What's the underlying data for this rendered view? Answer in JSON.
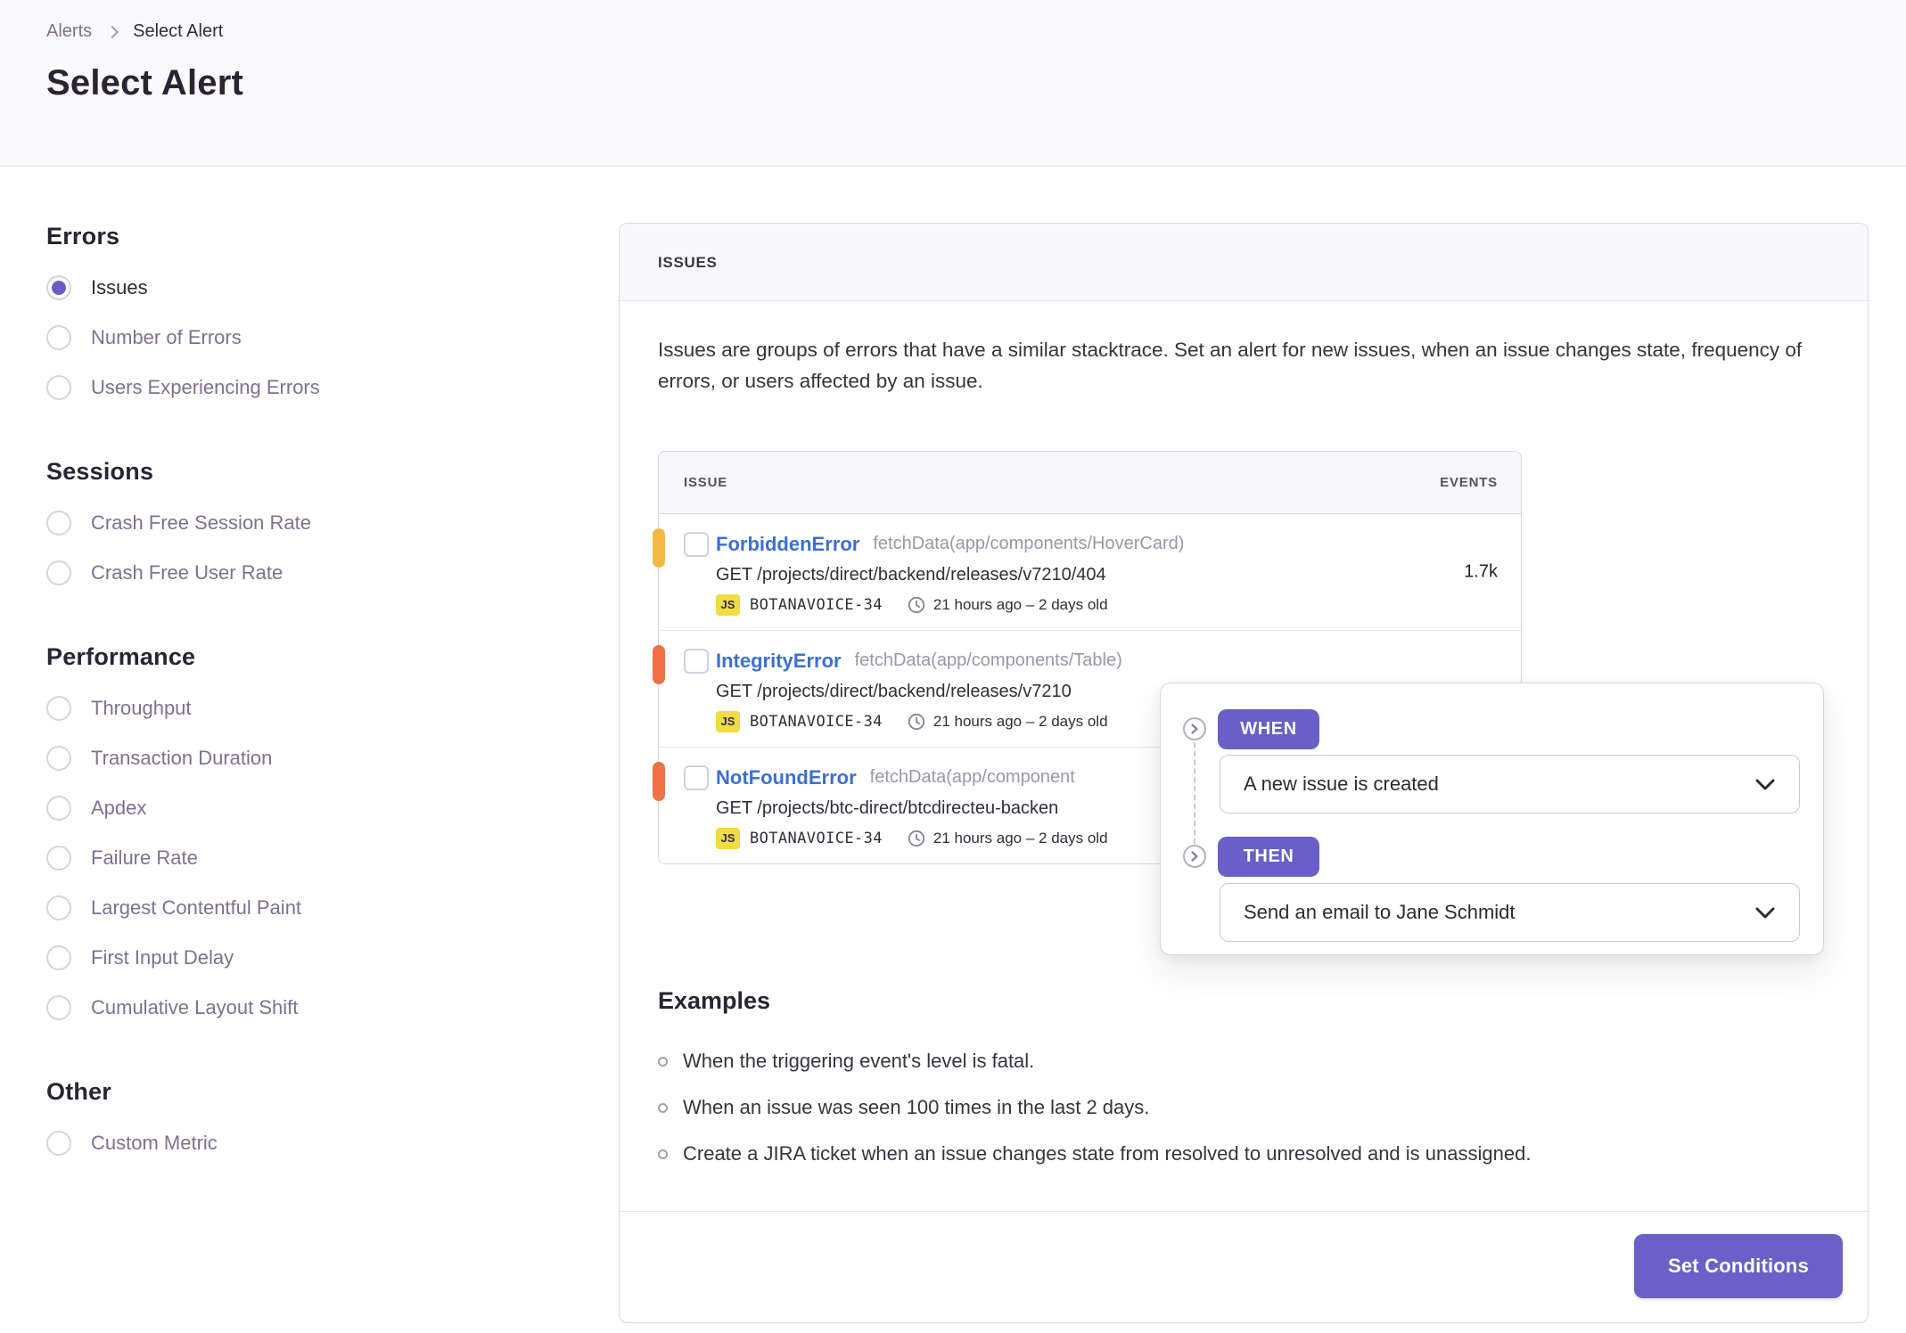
{
  "breadcrumb": {
    "parent": "Alerts",
    "current": "Select Alert"
  },
  "page_title": "Select Alert",
  "sidebar": {
    "sections": [
      {
        "title": "Errors",
        "options": [
          {
            "label": "Issues",
            "selected": true
          },
          {
            "label": "Number of Errors",
            "selected": false
          },
          {
            "label": "Users Experiencing Errors",
            "selected": false
          }
        ]
      },
      {
        "title": "Sessions",
        "options": [
          {
            "label": "Crash Free Session Rate",
            "selected": false
          },
          {
            "label": "Crash Free User Rate",
            "selected": false
          }
        ]
      },
      {
        "title": "Performance",
        "options": [
          {
            "label": "Throughput",
            "selected": false
          },
          {
            "label": "Transaction Duration",
            "selected": false
          },
          {
            "label": "Apdex",
            "selected": false
          },
          {
            "label": "Failure Rate",
            "selected": false
          },
          {
            "label": "Largest Contentful Paint",
            "selected": false
          },
          {
            "label": "First Input Delay",
            "selected": false
          },
          {
            "label": "Cumulative Layout Shift",
            "selected": false
          }
        ]
      },
      {
        "title": "Other",
        "options": [
          {
            "label": "Custom Metric",
            "selected": false
          }
        ]
      }
    ]
  },
  "panel": {
    "header": "ISSUES",
    "description": "Issues are groups of errors that have a similar stacktrace. Set an alert for new issues, when an issue changes state, frequency of errors, or users affected by an issue.",
    "table": {
      "columns": {
        "issue": "ISSUE",
        "events": "EVENTS"
      },
      "rows": [
        {
          "level_color": "#f2b947",
          "title": "ForbiddenError",
          "culprit": "fetchData(app/components/HoverCard)",
          "transaction": "GET /projects/direct/backend/releases/v7210/404",
          "platform_badge": "JS",
          "short_id": "BOTANAVOICE-34",
          "time": "21 hours ago – 2 days old",
          "events": "1.7k"
        },
        {
          "level_color": "#ee7147",
          "title": "IntegrityError",
          "culprit": "fetchData(app/components/Table)",
          "transaction": "GET /projects/direct/backend/releases/v7210",
          "platform_badge": "JS",
          "short_id": "BOTANAVOICE-34",
          "time": "21 hours ago – 2 days old",
          "events": ""
        },
        {
          "level_color": "#ee7147",
          "title": "NotFoundError",
          "culprit": "fetchData(app/component",
          "transaction": "GET /projects/btc-direct/btcdirecteu-backen",
          "platform_badge": "JS",
          "short_id": "BOTANAVOICE-34",
          "time": "21 hours ago – 2 days old",
          "events": ""
        }
      ]
    },
    "flow_overlay": {
      "when_label": "WHEN",
      "when_value": "A new issue is created",
      "then_label": "THEN",
      "then_value": "Send an email to Jane Schmidt"
    },
    "examples": {
      "title": "Examples",
      "items": [
        "When the triggering event's level is fatal.",
        "When an issue was seen 100 times in the last 2 days.",
        "Create a JIRA ticket when an issue changes state from resolved to unresolved and is unassigned."
      ]
    },
    "footer": {
      "submit_label": "Set Conditions"
    }
  },
  "icons": {
    "breadcrumb_separator": "chevron-right",
    "clock": "clock",
    "flow_step": "circle-chevron-right",
    "dropdown": "chevron-down"
  },
  "colors": {
    "accent_purple": "#6c5fc7",
    "link_blue": "#3d6fd2",
    "level_warning": "#f2b947",
    "level_error": "#ee7147",
    "platform_badge_bg": "#f0dc43",
    "muted_text": "#80708f"
  }
}
